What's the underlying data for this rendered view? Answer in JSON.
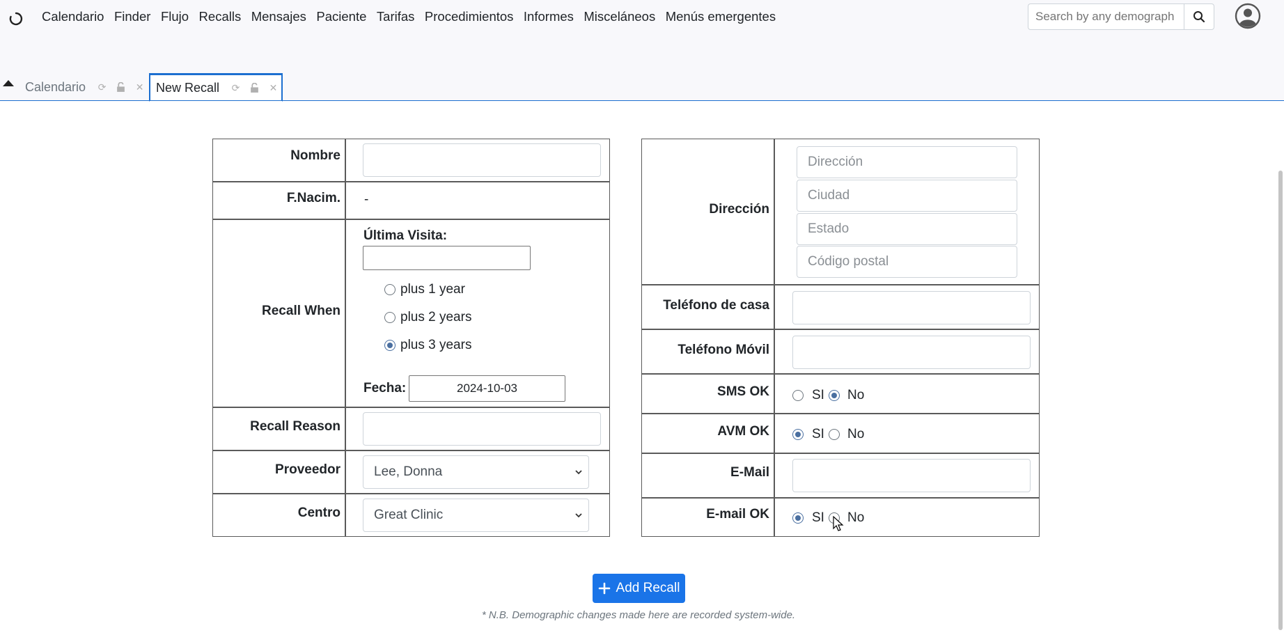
{
  "nav": {
    "menu": [
      "Calendario",
      "Finder",
      "Flujo",
      "Recalls",
      "Mensajes",
      "Paciente",
      "Tarifas",
      "Procedimientos",
      "Informes",
      "Misceláneos",
      "Menús emergentes"
    ],
    "search_placeholder": "Search by any demograph"
  },
  "tabs": [
    {
      "label": "Calendario",
      "active": false
    },
    {
      "label": "New Recall",
      "active": true
    }
  ],
  "left": {
    "nombre_label": "Nombre",
    "nombre_value": "",
    "fnacim_label": "F.Nacim.",
    "fnacim_value": "-",
    "recall_when_label": "Recall When",
    "ultima_visita_label": "Última Visita:",
    "ultima_visita_value": "",
    "options": [
      {
        "label": "plus 1 year",
        "selected": false
      },
      {
        "label": "plus 2 years",
        "selected": false
      },
      {
        "label": "plus 3 years",
        "selected": true
      }
    ],
    "fecha_label": "Fecha:",
    "fecha_value": "2024-10-03",
    "recall_reason_label": "Recall Reason",
    "recall_reason_value": "",
    "proveedor_label": "Proveedor",
    "proveedor_value": "Lee, Donna",
    "centro_label": "Centro",
    "centro_value": "Great Clinic"
  },
  "right": {
    "direccion_label": "Dirección",
    "direccion_placeholder": "Dirección",
    "ciudad_placeholder": "Ciudad",
    "estado_placeholder": "Estado",
    "postal_placeholder": "Código postal",
    "tel_casa_label": "Teléfono de casa",
    "tel_movil_label": "Teléfono Móvil",
    "sms_label": "SMS OK",
    "avm_label": "AVM OK",
    "email_label": "E-Mail",
    "email_ok_label": "E-mail OK",
    "si": "SI",
    "no": "No",
    "sms_value": "No",
    "avm_value": "SI",
    "email_ok_value": "SI"
  },
  "add_button": "Add Recall",
  "note": "* N.B. Demographic changes made here are recorded system-wide.",
  "colors": {
    "accent": "#1a74e8",
    "tab_border": "#1c6fd0",
    "radio_checked": "#4a6fa0"
  }
}
